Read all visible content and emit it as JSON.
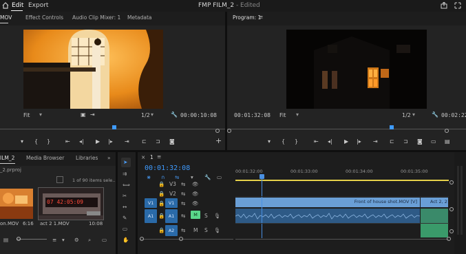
{
  "menu": {
    "home_icon": "home-icon",
    "edit": "Edit",
    "export": "Export"
  },
  "document": {
    "title": "FMP FILM_2",
    "edited": "- Edited"
  },
  "source_panel": {
    "tabs": [
      "MOV",
      "Effect Controls",
      "Audio Clip Mixer: 1",
      "Metadata"
    ],
    "fit": "Fit",
    "resolution": "1/2",
    "timecode": "00:00:10:08"
  },
  "program_panel": {
    "title": "Program: 1",
    "timecode_current": "00:01:32:08",
    "fit": "Fit",
    "resolution": "1/2",
    "timecode_duration": "00:02:22"
  },
  "project_panel": {
    "tabs": [
      "ILM_2",
      "Media Browser",
      "Libraries"
    ],
    "project_file": "_2.prproj",
    "items_count": "1 of 90 items sele...",
    "thumbnails": [
      {
        "name": "on.MOV",
        "duration": "6:16"
      },
      {
        "name": "act 2 1.MOV",
        "duration": "10:08",
        "overlay": "07 42:05:09"
      }
    ]
  },
  "timeline": {
    "tab": "1",
    "timecode": "00:01:32:08",
    "ruler": [
      "00:01:32:00",
      "00:01:33:00",
      "00:01:34:00",
      "00:01:35:00"
    ],
    "tracks": {
      "v3": "V3",
      "v2": "V2",
      "v1": "V1",
      "v1_source": "V1",
      "a1": "A1",
      "a1_source": "A1",
      "a2": "A2",
      "mute": "M",
      "solo": "S"
    },
    "clips": {
      "front_of_house": "Front of house shot.MOV [V]",
      "act2": "Act 2, 2"
    }
  },
  "colors": {
    "accent_blue": "#3f9bff",
    "clip_video": "#6a9fd6",
    "clip_audio": "#2e5a86",
    "clip_audio_green": "#3a9a6a",
    "playhead": "#4a90e2"
  }
}
